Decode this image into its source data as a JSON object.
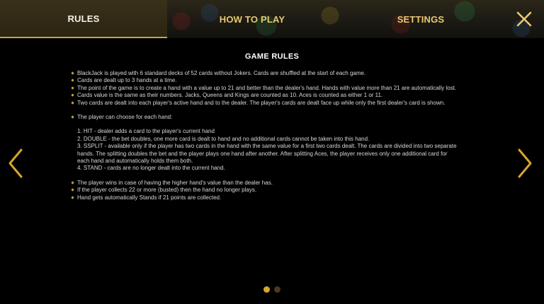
{
  "colors": {
    "accent": "#e8c970",
    "bullet": "#c9a44a",
    "dot_active": "#d9a531",
    "dot_inactive": "#4a3a1e",
    "background": "#000000"
  },
  "tabs": [
    {
      "label": "RULES",
      "active": true
    },
    {
      "label": "HOW TO PLAY",
      "active": false
    },
    {
      "label": "SETTINGS",
      "active": false
    }
  ],
  "close_icon": "close-icon",
  "page_title": "GAME RULES",
  "rules": {
    "b1": "BlackJack is played with 6 standard decks of 52 cards without Jokers. Cards are shuffled at the start of each game.",
    "b2": "Cards are dealt up to 3 hands at a time.",
    "b3": "The point of the game is to create a hand with a value up to 21 and better than the dealer's hand. Hands with value more than 21 are automatically lost.",
    "b4": "Cards value is the same as their numbers. Jacks, Queens and Kings are counted as 10. Aces is counted as either 1 or 11.",
    "b5": "Two cards are dealt into each player's active hand and to the dealer. The player's cards are dealt face up while only the first dealer's card is shown.",
    "b6": "The player can choose for each hand:",
    "o1": "1. HIT - dealer adds a card to the player's current hand",
    "o2": "2. DOUBLE - the bet doubles, one more card is dealt to hand and no additional cards cannot be taken into this hand.",
    "o3": "3. SSPLIT - available only if the player has two cards in the hand with the same value for a first two cards dealt. The cards are divided into two separate hands. The splitting doubles the bet and the player plays one hand after another. After splitting Aces, the player receives only one additional card for each hand and automatically holds them both.",
    "o4": "4. STAND - cards are no longer dealt into the current hand.",
    "b7": "The player wins in case of having the higher hand's value than the dealer has.",
    "b8": "If the player collects 22 or more (busted) then the hand no longer plays.",
    "b9": "Hand gets automatically Stands if 21 points are collected."
  },
  "navigation": {
    "left_icon": "chevron-left-icon",
    "right_icon": "chevron-right-icon",
    "page_count": 2,
    "current_page": 1
  }
}
